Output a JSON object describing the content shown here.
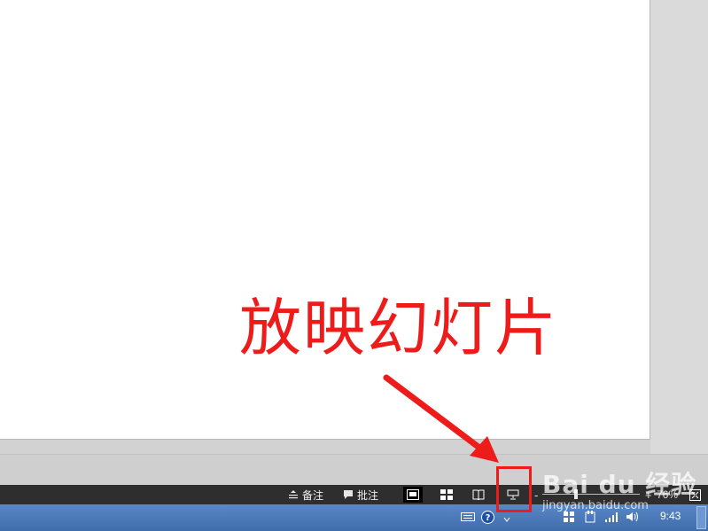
{
  "annotation": {
    "text": "放映幻灯片",
    "color": "#ee1b1b"
  },
  "status_bar": {
    "notes_label": "备注",
    "comments_label": "批注",
    "views": [
      {
        "name": "normal-view",
        "icon": "normal-view-icon",
        "active": true
      },
      {
        "name": "slide-sorter-view",
        "icon": "slide-sorter-icon",
        "active": false
      },
      {
        "name": "reading-view",
        "icon": "reading-view-icon",
        "active": false
      },
      {
        "name": "slide-show-view",
        "icon": "slide-show-icon",
        "active": false
      }
    ],
    "zoom_minus": "-",
    "zoom_plus": "+",
    "zoom_level": "76%",
    "fit_icon": "fit-to-window-icon"
  },
  "taskbar": {
    "clock": "9:43",
    "tray_icons": [
      "keyboard-icon",
      "help-icon",
      "expand-arrow-icon",
      "flag-icon",
      "power-icon",
      "network-icon",
      "volume-icon"
    ]
  },
  "watermark": {
    "main": "Bai du 经验",
    "sub": "jingyan.baidu.com"
  }
}
